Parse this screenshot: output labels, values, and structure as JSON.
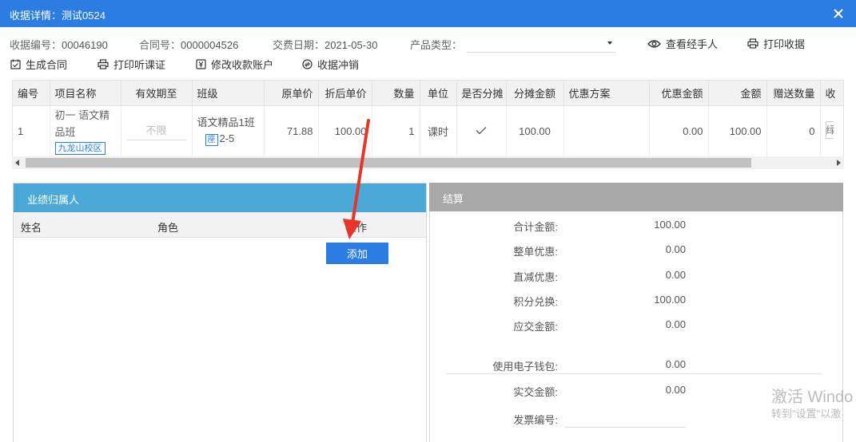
{
  "window": {
    "title": "收据详情：测试0524"
  },
  "info": {
    "receipt_no_label": "收据编号：",
    "receipt_no": "00046190",
    "contract_no_label": "合同号：",
    "contract_no": "0000004526",
    "pay_date_label": "交费日期：",
    "pay_date": "2021-05-30",
    "product_type_label": "产品类型："
  },
  "toolbar": {
    "view_handler": "查看经手人",
    "print_receipt": "打印收据",
    "gen_contract": "生成合同",
    "print_trial": "打印听课证",
    "modify_account": "修改收款账户",
    "receipt_reverse": "收据冲销"
  },
  "grid": {
    "headers": [
      "编号",
      "项目名称",
      "有效期至",
      "班级",
      "原单价",
      "折后单价",
      "数量",
      "单位",
      "是否分摊",
      "分摊金额",
      "优惠方案",
      "优惠金额",
      "金额",
      "赠送数量",
      "收"
    ],
    "row": {
      "no": "1",
      "project_name": "初一 语文精品班",
      "campus": "九龙山校区",
      "validity": "不限",
      "class_name": "语文精品1班",
      "seat_tag": "座",
      "seat": "2-5",
      "orig_price": "71.88",
      "disc_price": "100.00",
      "qty": "1",
      "unit": "课时",
      "alloc_amount": "100.00",
      "discount_plan": "",
      "discount_amount": "0.00",
      "amount": "100.00",
      "gift_qty": "0",
      "partial": "绿"
    }
  },
  "performance": {
    "title": "业绩归属人",
    "col_name": "姓名",
    "col_role": "角色",
    "col_op": "操作",
    "add_btn": "添加"
  },
  "settlement": {
    "title": "结算",
    "rows": [
      {
        "label": "合计金额:",
        "value": "100.00"
      },
      {
        "label": "整单优惠:",
        "value": "0.00"
      },
      {
        "label": "直减优惠:",
        "value": "0.00"
      },
      {
        "label": "积分兑换:",
        "value": "100.00"
      },
      {
        "label": "应交金额:",
        "value": "0.00"
      }
    ],
    "rows2": [
      {
        "label": "使用电子钱包:",
        "value": "0.00"
      },
      {
        "label": "实交金额:",
        "value": "0.00"
      }
    ],
    "invoice_label": "发票编号:"
  },
  "watermark": {
    "line1": "激活 Windo",
    "line2": "转到\"设置\"以激"
  },
  "colors": {
    "titlebar": "#2b7de4",
    "performance_header": "#4aa9d6",
    "settlement_header": "#a8a8a8",
    "primary_button": "#2b7de4",
    "annotation_arrow": "#e8352a"
  }
}
